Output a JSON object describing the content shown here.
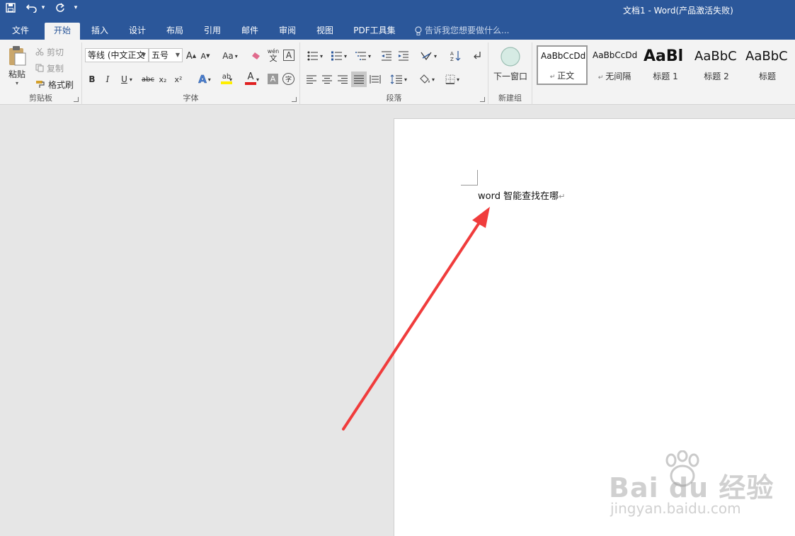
{
  "titlebar": {
    "document_title": "文档1 - Word(产品激活失败)",
    "quick_access": {
      "undo_dropdown": "▾",
      "customize": "▾"
    }
  },
  "tabs": [
    {
      "id": "file",
      "label": "文件"
    },
    {
      "id": "home",
      "label": "开始"
    },
    {
      "id": "insert",
      "label": "插入"
    },
    {
      "id": "design",
      "label": "设计"
    },
    {
      "id": "layout",
      "label": "布局"
    },
    {
      "id": "references",
      "label": "引用"
    },
    {
      "id": "mailings",
      "label": "邮件"
    },
    {
      "id": "review",
      "label": "审阅"
    },
    {
      "id": "view",
      "label": "视图"
    },
    {
      "id": "pdf",
      "label": "PDF工具集"
    }
  ],
  "active_tab": "开始",
  "tell_me": {
    "placeholder": "告诉我您想要做什么..."
  },
  "ribbon": {
    "clipboard": {
      "label": "剪贴板",
      "paste": "粘贴",
      "cut": "剪切",
      "copy": "复制",
      "format_painter": "格式刷"
    },
    "font": {
      "label": "字体",
      "font_name": "等线 (中文正文",
      "font_size": "五号",
      "bold": "B",
      "italic": "I",
      "underline": "U",
      "strikethrough": "abc",
      "subscript": "x₂",
      "superscript": "x²",
      "change_case": "Aa",
      "phonetic": "wén",
      "phonetic_char": "文",
      "char_border": "A",
      "grow": "A",
      "shrink": "A",
      "font_color": "A",
      "shading": "A",
      "enclose": "字",
      "highlight": "ab"
    },
    "paragraph": {
      "label": "段落"
    },
    "new_group": {
      "label": "新建组",
      "next_window": "下一窗口"
    },
    "styles": [
      {
        "preview": "AaBbCcDd",
        "name": "正文",
        "selected": true
      },
      {
        "preview": "AaBbCcDd",
        "name": "无间隔",
        "selected": false
      },
      {
        "preview": "AaBl",
        "name": "标题 1",
        "selected": false
      },
      {
        "preview": "AaBbC",
        "name": "标题 2",
        "selected": false
      },
      {
        "preview": "AaBbC",
        "name": "标题",
        "selected": false
      }
    ]
  },
  "document": {
    "text": "word 智能查找在哪",
    "paragraph_mark": "↵"
  },
  "watermark": {
    "brand": "Bai du 经验",
    "url": "jingyan.baidu.com"
  },
  "colors": {
    "title_blue": "#2b579a",
    "ribbon_bg": "#f3f3f3",
    "canvas_gray": "#e6e6e6",
    "arrow_red": "#f03c3c",
    "font_color_bar": "#e02020",
    "highlight_bar": "#ffee00"
  }
}
